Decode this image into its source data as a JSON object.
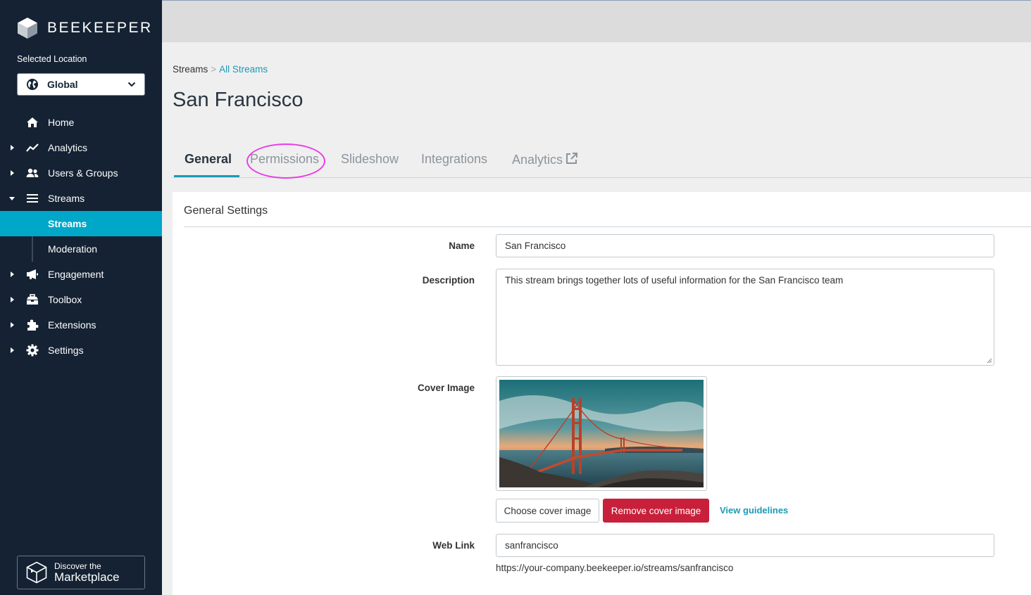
{
  "brand": {
    "name": "BEEKEEPER"
  },
  "location": {
    "label": "Selected Location",
    "value": "Global"
  },
  "nav": {
    "items": [
      {
        "label": "Home"
      },
      {
        "label": "Analytics"
      },
      {
        "label": "Users & Groups"
      },
      {
        "label": "Streams"
      },
      {
        "label": "Engagement"
      },
      {
        "label": "Toolbox"
      },
      {
        "label": "Extensions"
      },
      {
        "label": "Settings"
      }
    ],
    "streams_sub": [
      {
        "label": "Streams",
        "active": true
      },
      {
        "label": "Moderation",
        "active": false
      }
    ]
  },
  "marketplace": {
    "line1": "Discover the",
    "line2": "Marketplace"
  },
  "breadcrumb": {
    "root": "Streams",
    "separator": ">",
    "current": "All Streams"
  },
  "page": {
    "title": "San Francisco"
  },
  "tabs": [
    {
      "label": "General",
      "active": true
    },
    {
      "label": "Permissions",
      "active": false
    },
    {
      "label": "Slideshow",
      "active": false
    },
    {
      "label": "Integrations",
      "active": false
    },
    {
      "label": "Analytics",
      "active": false,
      "icon": "external-link-icon"
    }
  ],
  "form": {
    "section_title": "General Settings",
    "name_label": "Name",
    "name_value": "San Francisco",
    "description_label": "Description",
    "description_value": "This stream brings together lots of useful information for the San Francisco team",
    "cover_label": "Cover Image",
    "choose_button": "Choose cover image",
    "remove_button": "Remove cover image",
    "guidelines_link": "View guidelines",
    "weblink_label": "Web Link",
    "weblink_value": "sanfrancisco",
    "weblink_url": "https://your-company.beekeeper.io/streams/sanfrancisco"
  },
  "colors": {
    "sidebar": "#142233",
    "accent": "#00a7c9",
    "link": "#1c9ab6",
    "danger": "#c8203a",
    "highlight": "#e83ee8"
  }
}
